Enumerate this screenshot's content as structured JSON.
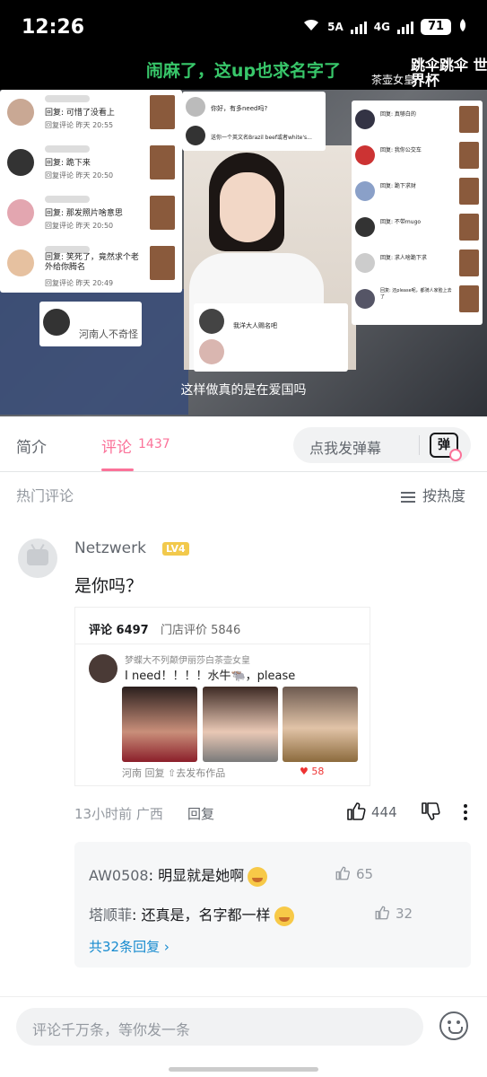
{
  "status_bar": {
    "time": "12:26",
    "network_5g": "5A",
    "network_4g": "4G",
    "battery": "71"
  },
  "video": {
    "caption_top": "闹麻了，这up也求名字了",
    "watermark_small": "茶壶女皇",
    "watermark_large": "跳伞跳伞 世界杯",
    "caption_bottom": "这样做真的是在爱国吗",
    "cards": [
      {
        "reply": "回复: 可惜了没看上",
        "meta": "回复评论  昨天 20:55"
      },
      {
        "reply": "回复: 跪下来",
        "meta": "回复评论  昨天 20:50"
      },
      {
        "reply": "回复: 那发照片啥意思",
        "meta": "回复评论  昨天 20:50"
      },
      {
        "reply": "回复: 笑死了，竟然求个老外给你腾名",
        "meta": "回复评论  昨天 20:49"
      }
    ],
    "card_right": [
      {
        "reply": "回复: 真够白的"
      },
      {
        "reply": "回复: 我你公交车"
      },
      {
        "reply": "回复: 跪下求财"
      },
      {
        "reply": "回复: 不带mugo"
      },
      {
        "reply": "回复: 求人啥跪下求"
      },
      {
        "reply": "回复: 还please呢，都骑人家脸上去了"
      }
    ],
    "mid_card_1": "你好，有多need吗?",
    "mid_card_2": "送你一个英文名Brazil beef或者white's...",
    "bottom_card_1": "河南人不奇怪",
    "bottom_card_2": "我洋大人赐名吧"
  },
  "tabs": {
    "intro": "简介",
    "comments": "评论",
    "comment_count": "1437",
    "danmu_placeholder": "点我发弹幕",
    "danmu_icon": "弹"
  },
  "comments_header": {
    "title": "热门评论",
    "sort": "按热度"
  },
  "comment": {
    "user": "Netzwerk",
    "level": "LV4",
    "text": "是你吗？",
    "time_location": "13小时前 广西",
    "reply_label": "回复",
    "likes": "444",
    "screenshot": {
      "tab_comments": "评论 6497",
      "tab_reviews": "门店评价 5846",
      "username": "梦蝶大不列颠伊丽莎白茶壶女皇",
      "text": "I need！！！！水牛🐃，please",
      "footer": "河南   回复   ⇧去发布作品",
      "hearts": "♥ 58"
    },
    "replies": [
      {
        "user": "AW0508",
        "text": "明显就是她啊",
        "likes": "65"
      },
      {
        "user": "塔顺菲",
        "text": "还真是，名字都一样",
        "likes": "32"
      }
    ],
    "more_replies": "共32条回复 ›"
  },
  "bottom_bar": {
    "placeholder": "评论千万条，等你发一条"
  },
  "colors": {
    "accent": "#fb7299",
    "link": "#178bcf",
    "caption_green": "#38c76a"
  }
}
